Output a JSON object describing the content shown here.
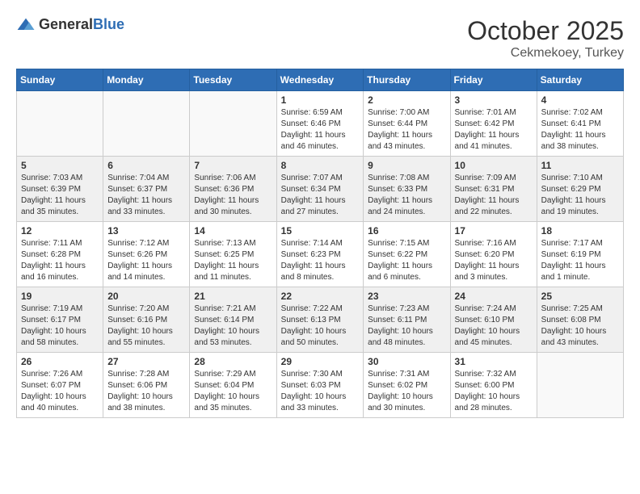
{
  "header": {
    "logo_general": "General",
    "logo_blue": "Blue",
    "month": "October 2025",
    "location": "Cekmekoey, Turkey"
  },
  "days_of_week": [
    "Sunday",
    "Monday",
    "Tuesday",
    "Wednesday",
    "Thursday",
    "Friday",
    "Saturday"
  ],
  "weeks": [
    [
      {
        "day": "",
        "info": ""
      },
      {
        "day": "",
        "info": ""
      },
      {
        "day": "",
        "info": ""
      },
      {
        "day": "1",
        "info": "Sunrise: 6:59 AM\nSunset: 6:46 PM\nDaylight: 11 hours\nand 46 minutes."
      },
      {
        "day": "2",
        "info": "Sunrise: 7:00 AM\nSunset: 6:44 PM\nDaylight: 11 hours\nand 43 minutes."
      },
      {
        "day": "3",
        "info": "Sunrise: 7:01 AM\nSunset: 6:42 PM\nDaylight: 11 hours\nand 41 minutes."
      },
      {
        "day": "4",
        "info": "Sunrise: 7:02 AM\nSunset: 6:41 PM\nDaylight: 11 hours\nand 38 minutes."
      }
    ],
    [
      {
        "day": "5",
        "info": "Sunrise: 7:03 AM\nSunset: 6:39 PM\nDaylight: 11 hours\nand 35 minutes."
      },
      {
        "day": "6",
        "info": "Sunrise: 7:04 AM\nSunset: 6:37 PM\nDaylight: 11 hours\nand 33 minutes."
      },
      {
        "day": "7",
        "info": "Sunrise: 7:06 AM\nSunset: 6:36 PM\nDaylight: 11 hours\nand 30 minutes."
      },
      {
        "day": "8",
        "info": "Sunrise: 7:07 AM\nSunset: 6:34 PM\nDaylight: 11 hours\nand 27 minutes."
      },
      {
        "day": "9",
        "info": "Sunrise: 7:08 AM\nSunset: 6:33 PM\nDaylight: 11 hours\nand 24 minutes."
      },
      {
        "day": "10",
        "info": "Sunrise: 7:09 AM\nSunset: 6:31 PM\nDaylight: 11 hours\nand 22 minutes."
      },
      {
        "day": "11",
        "info": "Sunrise: 7:10 AM\nSunset: 6:29 PM\nDaylight: 11 hours\nand 19 minutes."
      }
    ],
    [
      {
        "day": "12",
        "info": "Sunrise: 7:11 AM\nSunset: 6:28 PM\nDaylight: 11 hours\nand 16 minutes."
      },
      {
        "day": "13",
        "info": "Sunrise: 7:12 AM\nSunset: 6:26 PM\nDaylight: 11 hours\nand 14 minutes."
      },
      {
        "day": "14",
        "info": "Sunrise: 7:13 AM\nSunset: 6:25 PM\nDaylight: 11 hours\nand 11 minutes."
      },
      {
        "day": "15",
        "info": "Sunrise: 7:14 AM\nSunset: 6:23 PM\nDaylight: 11 hours\nand 8 minutes."
      },
      {
        "day": "16",
        "info": "Sunrise: 7:15 AM\nSunset: 6:22 PM\nDaylight: 11 hours\nand 6 minutes."
      },
      {
        "day": "17",
        "info": "Sunrise: 7:16 AM\nSunset: 6:20 PM\nDaylight: 11 hours\nand 3 minutes."
      },
      {
        "day": "18",
        "info": "Sunrise: 7:17 AM\nSunset: 6:19 PM\nDaylight: 11 hours\nand 1 minute."
      }
    ],
    [
      {
        "day": "19",
        "info": "Sunrise: 7:19 AM\nSunset: 6:17 PM\nDaylight: 10 hours\nand 58 minutes."
      },
      {
        "day": "20",
        "info": "Sunrise: 7:20 AM\nSunset: 6:16 PM\nDaylight: 10 hours\nand 55 minutes."
      },
      {
        "day": "21",
        "info": "Sunrise: 7:21 AM\nSunset: 6:14 PM\nDaylight: 10 hours\nand 53 minutes."
      },
      {
        "day": "22",
        "info": "Sunrise: 7:22 AM\nSunset: 6:13 PM\nDaylight: 10 hours\nand 50 minutes."
      },
      {
        "day": "23",
        "info": "Sunrise: 7:23 AM\nSunset: 6:11 PM\nDaylight: 10 hours\nand 48 minutes."
      },
      {
        "day": "24",
        "info": "Sunrise: 7:24 AM\nSunset: 6:10 PM\nDaylight: 10 hours\nand 45 minutes."
      },
      {
        "day": "25",
        "info": "Sunrise: 7:25 AM\nSunset: 6:08 PM\nDaylight: 10 hours\nand 43 minutes."
      }
    ],
    [
      {
        "day": "26",
        "info": "Sunrise: 7:26 AM\nSunset: 6:07 PM\nDaylight: 10 hours\nand 40 minutes."
      },
      {
        "day": "27",
        "info": "Sunrise: 7:28 AM\nSunset: 6:06 PM\nDaylight: 10 hours\nand 38 minutes."
      },
      {
        "day": "28",
        "info": "Sunrise: 7:29 AM\nSunset: 6:04 PM\nDaylight: 10 hours\nand 35 minutes."
      },
      {
        "day": "29",
        "info": "Sunrise: 7:30 AM\nSunset: 6:03 PM\nDaylight: 10 hours\nand 33 minutes."
      },
      {
        "day": "30",
        "info": "Sunrise: 7:31 AM\nSunset: 6:02 PM\nDaylight: 10 hours\nand 30 minutes."
      },
      {
        "day": "31",
        "info": "Sunrise: 7:32 AM\nSunset: 6:00 PM\nDaylight: 10 hours\nand 28 minutes."
      },
      {
        "day": "",
        "info": ""
      }
    ]
  ]
}
